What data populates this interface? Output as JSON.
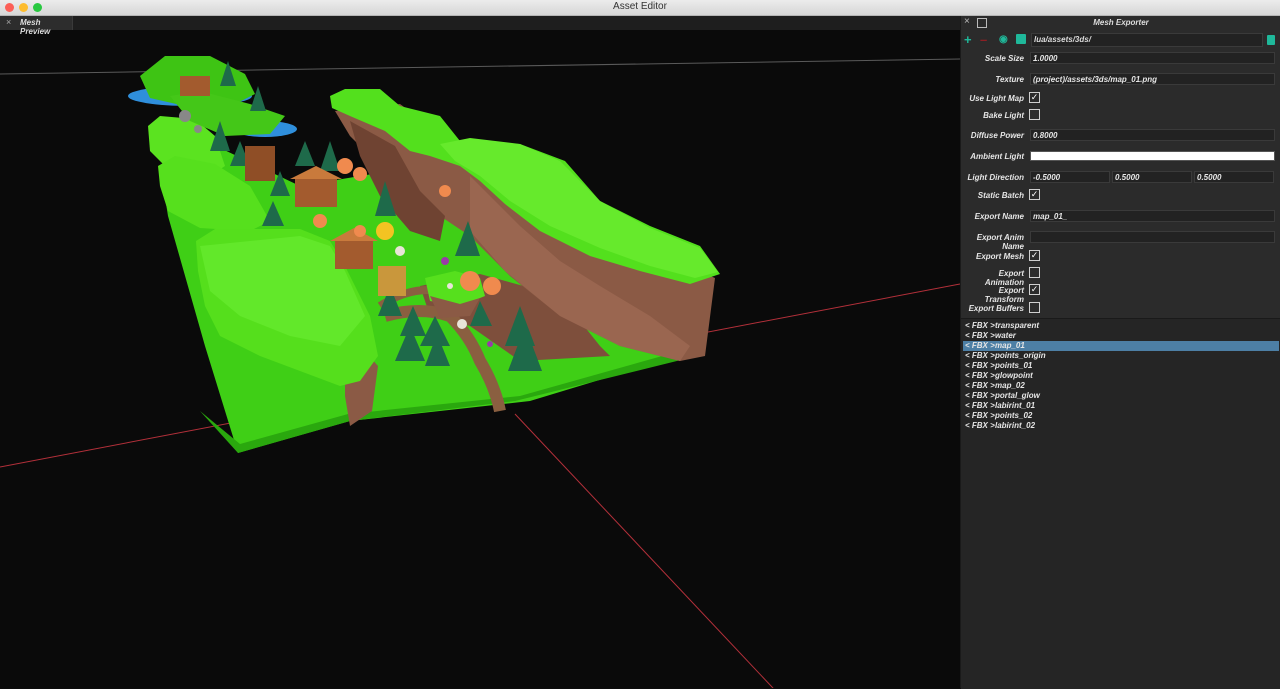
{
  "window": {
    "title": "Asset Editor"
  },
  "viewport_tab": {
    "close": "×",
    "label": "Mesh Preview"
  },
  "panel": {
    "title": "Mesh Exporter",
    "path": "lua/assets/3ds/",
    "props": {
      "scale_size": {
        "label": "Scale Size",
        "value": "1.0000"
      },
      "texture": {
        "label": "Texture",
        "value": "(project)/assets/3ds/map_01.png"
      },
      "use_light_map": {
        "label": "Use Light Map",
        "checked": "✓"
      },
      "bake_light": {
        "label": "Bake Light",
        "checked": ""
      },
      "diffuse_power": {
        "label": "Diffuse Power",
        "value": "0.8000"
      },
      "ambient_light": {
        "label": "Ambient Light",
        "color": "#ffffff"
      },
      "light_direction": {
        "label": "Light Direction",
        "x": "-0.5000",
        "y": "0.5000",
        "z": "0.5000"
      },
      "static_batch": {
        "label": "Static Batch",
        "checked": "✓"
      },
      "export_name": {
        "label": "Export Name",
        "value": "map_01_"
      },
      "export_anim_name": {
        "label": "Export Anim Name",
        "value": ""
      },
      "export_mesh": {
        "label": "Export Mesh",
        "checked": "✓"
      },
      "export_animation": {
        "label": "Export Animation",
        "checked": ""
      },
      "export_transform": {
        "label": "Export Transform",
        "checked": "✓"
      },
      "export_buffers": {
        "label": "Export Buffers",
        "checked": ""
      }
    },
    "list": [
      {
        "tag": "< FBX >",
        "name": "transparent"
      },
      {
        "tag": "< FBX >",
        "name": "water"
      },
      {
        "tag": "< FBX >",
        "name": "map_01"
      },
      {
        "tag": "< FBX >",
        "name": "points_origin"
      },
      {
        "tag": "< FBX >",
        "name": "points_01"
      },
      {
        "tag": "< FBX >",
        "name": "glowpoint"
      },
      {
        "tag": "< FBX >",
        "name": "map_02"
      },
      {
        "tag": "< FBX >",
        "name": "portal_glow"
      },
      {
        "tag": "< FBX >",
        "name": "labirint_01"
      },
      {
        "tag": "< FBX >",
        "name": "points_02"
      },
      {
        "tag": "< FBX >",
        "name": "labirint_02"
      }
    ],
    "selected_index": 2
  },
  "icons": [
    "add-icon",
    "remove-icon",
    "eye-icon",
    "save-icon",
    "trash-icon",
    "close-icon",
    "float-window-icon"
  ],
  "colors": {
    "accent": "#1fb89a",
    "selection": "#4d7fa5",
    "terrain": "#4fe21b",
    "cliff": "#8b5a45",
    "axis": "#b3303a"
  }
}
